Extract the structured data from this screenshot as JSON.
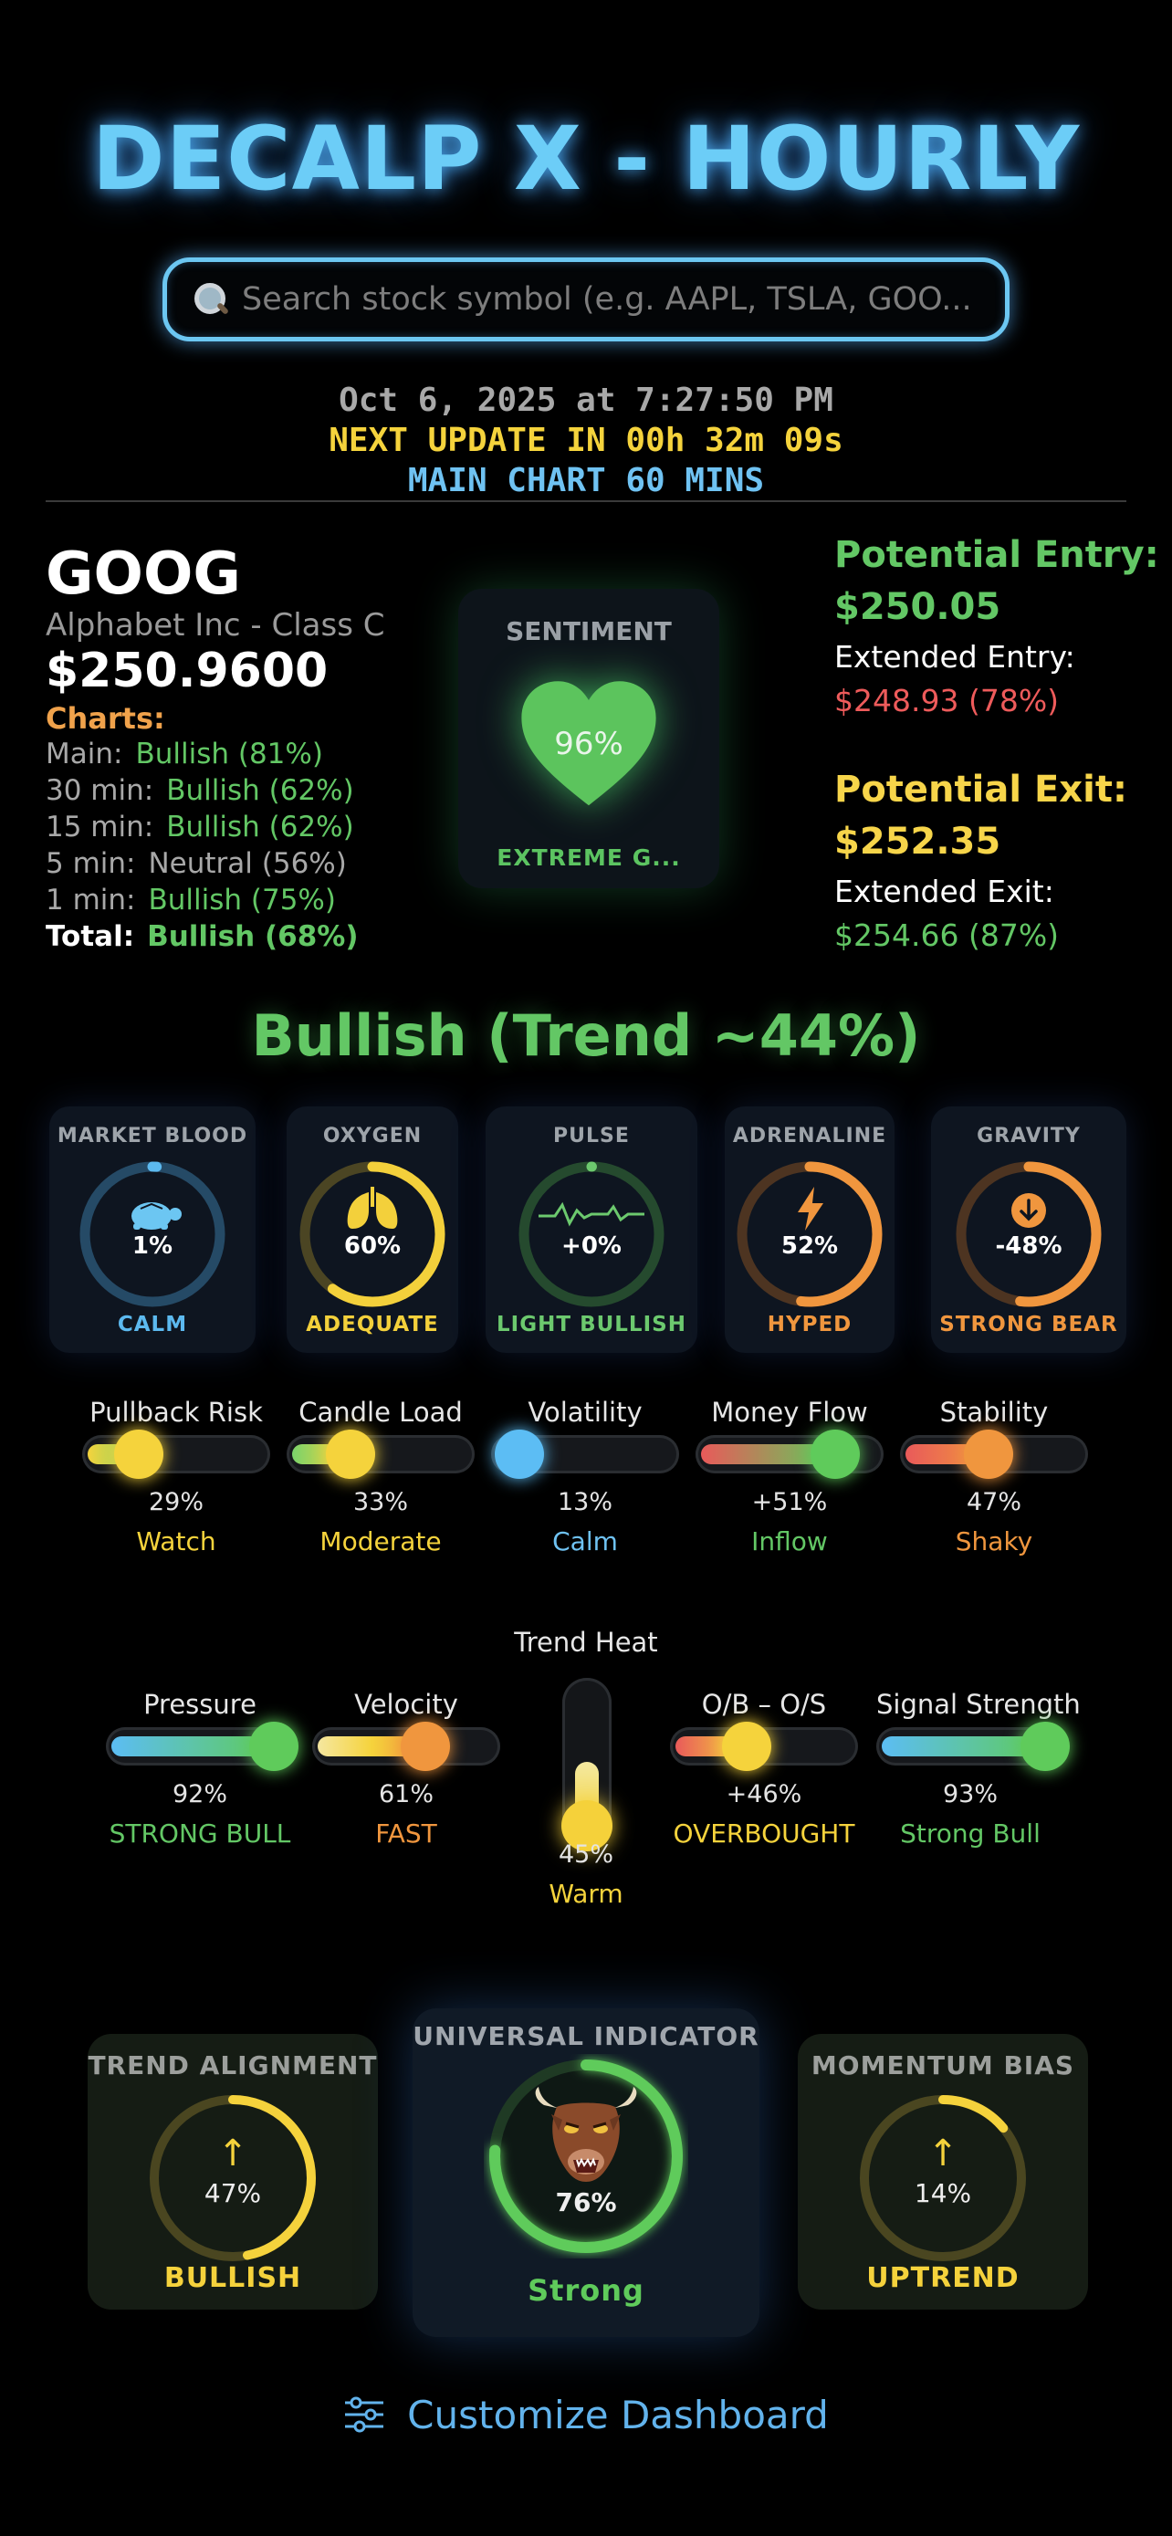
{
  "header": {
    "title": "DECALP X - HOURLY",
    "search_placeholder": "Search stock symbol (e.g. AAPL, TSLA, GOO...",
    "timestamp": "Oct 6, 2025 at 7:27:50 PM",
    "next_update": "NEXT UPDATE IN 00h 32m 09s",
    "main_chart": "MAIN CHART 60 MINS"
  },
  "stock": {
    "symbol": "GOOG",
    "company": "Alphabet Inc - Class C",
    "price": "$250.9600",
    "charts_label": "Charts:",
    "charts": [
      {
        "label": "Main:",
        "value": "Bullish (81%)"
      },
      {
        "label": "30 min:",
        "value": "Bullish (62%)"
      },
      {
        "label": "15 min:",
        "value": "Bullish (62%)"
      },
      {
        "label": "5 min:",
        "value": "Neutral (56%)"
      },
      {
        "label": "1 min:",
        "value": "Bullish (75%)"
      },
      {
        "label": "Total:",
        "value": "Bullish (68%)"
      }
    ]
  },
  "sentiment": {
    "label": "SENTIMENT",
    "value": "96%",
    "status": "EXTREME G..."
  },
  "levels": {
    "entry_label": "Potential Entry:",
    "entry_value": "$250.05",
    "ext_entry_label": "Extended Entry:",
    "ext_entry_value": "$248.93 (78%)",
    "exit_label": "Potential Exit:",
    "exit_value": "$252.35",
    "ext_exit_label": "Extended Exit:",
    "ext_exit_value": "$254.66 (87%)"
  },
  "trend_headline": "Bullish (Trend ~44%)",
  "vitals": [
    {
      "title": "MARKET BLOOD",
      "value": "1%",
      "status": "CALM",
      "icon": "turtle-icon",
      "fraction": 0.01,
      "color": "#3d8fcb",
      "status_color": "#5cb9ef"
    },
    {
      "title": "OXYGEN",
      "value": "60%",
      "status": "ADEQUATE",
      "icon": "lungs-icon",
      "fraction": 0.6,
      "color": "#f3d03b",
      "status_color": "#f3d03b"
    },
    {
      "title": "PULSE",
      "value": "+0%",
      "status": "LIGHT BULLISH",
      "icon": "heartbeat-icon",
      "fraction": 0.0,
      "color": "#3b8a4a",
      "status_color": "#6cc96e"
    },
    {
      "title": "ADRENALINE",
      "value": "52%",
      "status": "HYPED",
      "icon": "bolt-icon",
      "fraction": 0.52,
      "color": "#f0963e",
      "status_color": "#f0963e"
    },
    {
      "title": "GRAVITY",
      "value": "-48%",
      "status": "STRONG BEAR",
      "icon": "down-arrow-icon",
      "fraction": 0.52,
      "color": "#f0963e",
      "status_color": "#f0963e"
    }
  ],
  "sliders_row1": [
    {
      "label": "Pullback Risk",
      "value": "29%",
      "status": "Watch",
      "fraction": 0.29,
      "color": "#f5d33c",
      "status_color": "#f5d33c"
    },
    {
      "label": "Candle Load",
      "value": "33%",
      "status": "Moderate",
      "fraction": 0.33,
      "color": "#f5d33c",
      "status_color": "#f5d33c"
    },
    {
      "label": "Volatility",
      "value": "13%",
      "status": "Calm",
      "fraction": 0.13,
      "color": "#5cbdf4",
      "status_color": "#6fc2f2"
    },
    {
      "label": "Money Flow",
      "value": "+51%",
      "status": "Inflow",
      "fraction": 0.76,
      "color": "#5fcb5b",
      "status_color": "#63c765"
    },
    {
      "label": "Stability",
      "value": "47%",
      "status": "Shaky",
      "fraction": 0.47,
      "color": "#f0963e",
      "status_color": "#f0963e"
    }
  ],
  "sliders_row2": [
    {
      "label": "Pressure",
      "value": "92%",
      "status": "STRONG BULL",
      "fraction": 0.92,
      "color": "#5fcb5b",
      "status_color": "#63c765"
    },
    {
      "label": "Velocity",
      "value": "61%",
      "status": "FAST",
      "fraction": 0.61,
      "color": "#f0963e",
      "status_color": "#f0963e"
    },
    {
      "label": "O/B – O/S",
      "value": "+46%",
      "status": "OVERBOUGHT",
      "fraction": 0.4,
      "color": "#f5d33c",
      "status_color": "#f5d33c"
    },
    {
      "label": "Signal Strength",
      "value": "93%",
      "status": "Strong Bull",
      "fraction": 0.93,
      "color": "#5fcb5b",
      "status_color": "#63c765"
    }
  ],
  "trend_heat": {
    "label": "Trend Heat",
    "value": "45%",
    "status": "Warm",
    "fraction": 0.45
  },
  "gauges": {
    "trend_alignment": {
      "title": "TREND ALIGNMENT",
      "value": "47%",
      "status": "BULLISH",
      "fraction": 0.47
    },
    "universal": {
      "title": "UNIVERSAL INDICATOR",
      "value": "76%",
      "status": "Strong",
      "fraction": 0.76,
      "icon": "bull-icon"
    },
    "momentum_bias": {
      "title": "MOMENTUM BIAS",
      "value": "14%",
      "status": "UPTREND",
      "fraction": 0.14
    }
  },
  "customize_label": "Customize Dashboard"
}
